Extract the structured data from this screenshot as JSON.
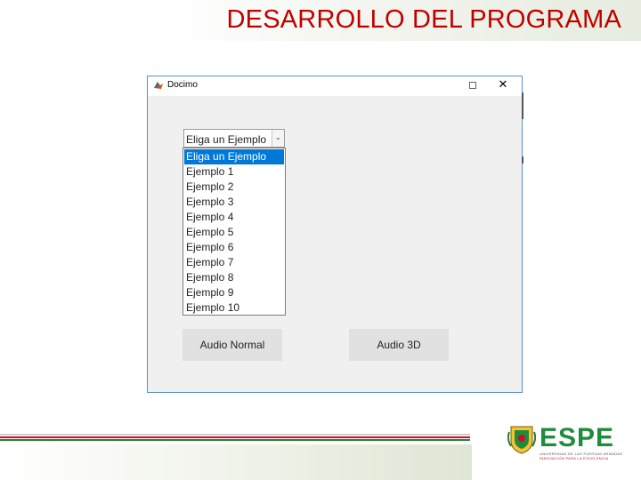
{
  "slide": {
    "title": "DESARROLLO DEL PROGRAMA"
  },
  "window": {
    "title": "Docimo",
    "close_glyph": "✕"
  },
  "combo": {
    "selected_value": "Eliga un Ejemplo",
    "arrow_glyph": "⌄"
  },
  "dropdown": {
    "options": [
      "Eliga un Ejemplo",
      "Ejemplo 1",
      "Ejemplo 2",
      "Ejemplo 3",
      "Ejemplo 4",
      "Ejemplo 5",
      "Ejemplo 6",
      "Ejemplo 7",
      "Ejemplo 8",
      "Ejemplo 9",
      "Ejemplo 10"
    ],
    "highlighted_option": "Eliga un Ejemplo"
  },
  "buttons": {
    "audio_normal": "Audio Normal",
    "audio_3d": "Audio 3D"
  },
  "logo": {
    "name": "ESPE",
    "subtitle": "UNIVERSIDAD DE LAS FUERZAS ARMADAS",
    "tagline": "INNOVACIÓN PARA LA EXCELENCIA"
  },
  "colors": {
    "title_red": "#c00000",
    "selection_blue": "#0078d7",
    "window_border": "#5a8ed0",
    "logo_green": "#1f8b3c",
    "stripe_red": "#c8102e",
    "stripe_green": "#2e7d32"
  }
}
